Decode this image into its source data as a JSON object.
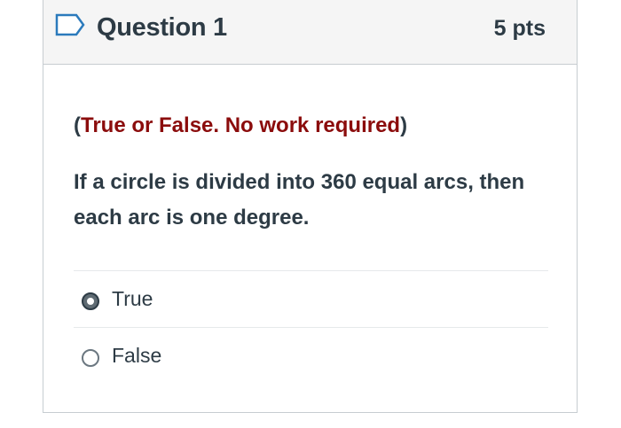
{
  "question": {
    "title": "Question 1",
    "points": "5 pts",
    "instructions_open": "(",
    "instructions_text": "True or False. No work required",
    "instructions_close": ")",
    "text": "If a circle is divided into 360 equal arcs, then each arc is one degree."
  },
  "answers": [
    {
      "label": "True",
      "selected": true
    },
    {
      "label": "False",
      "selected": false
    }
  ],
  "colors": {
    "instruction_red": "#8b0c0c",
    "header_bg": "#f5f5f5",
    "flag_blue": "#2b7abc"
  },
  "icons": {
    "flag": "bookmark-flag-icon"
  }
}
